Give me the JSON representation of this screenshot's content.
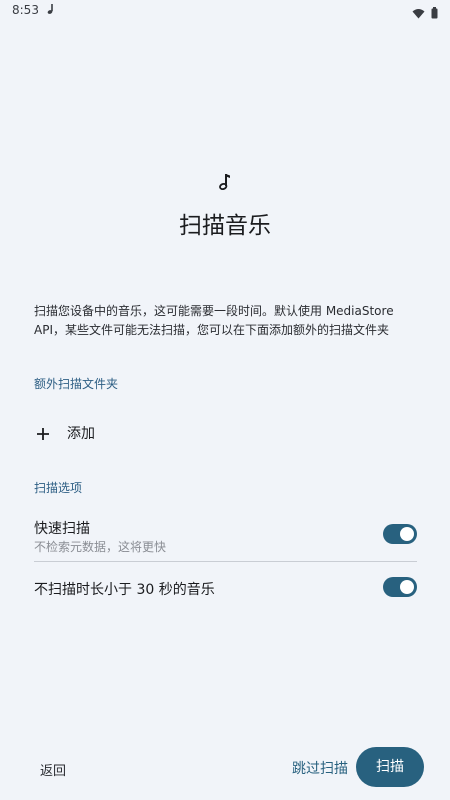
{
  "status_bar": {
    "time": "8:53",
    "app_icon": "music-note-icon",
    "wifi_icon": "wifi-icon",
    "battery_icon": "battery-icon"
  },
  "hero": {
    "icon": "music-note-icon",
    "title": "扫描音乐"
  },
  "description": "扫描您设备中的音乐，这可能需要一段时间。默认使用 MediaStore API，某些文件可能无法扫描，您可以在下面添加额外的扫描文件夹",
  "extra_folders": {
    "header": "额外扫描文件夹",
    "add_icon": "plus-icon",
    "add_label": "添加"
  },
  "scan_options": {
    "header": "扫描选项",
    "quick_scan": {
      "title": "快速扫描",
      "subtitle": "不检索元数据，这将更快",
      "enabled": true
    },
    "skip_short": {
      "title": "不扫描时长小于 30 秒的音乐",
      "enabled": true
    }
  },
  "footer": {
    "back_label": "返回",
    "skip_label": "跳过扫描",
    "scan_label": "扫描"
  },
  "colors": {
    "background": "#f1f4f9",
    "accent": "#28617f",
    "section_header": "#2d5e84"
  }
}
